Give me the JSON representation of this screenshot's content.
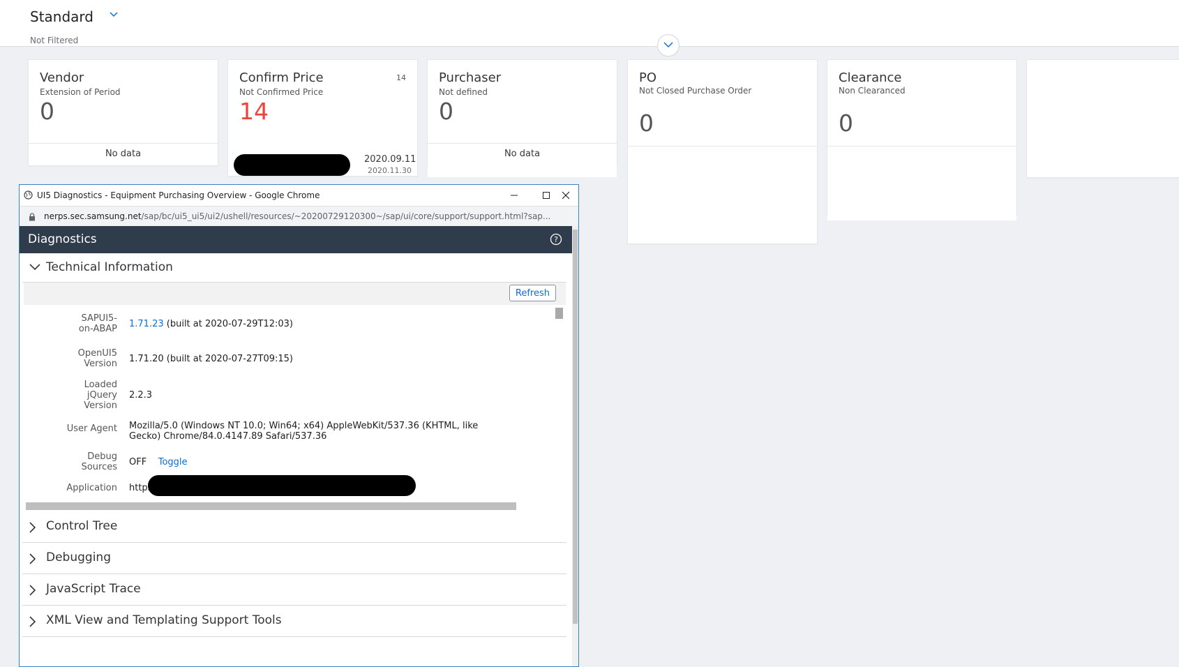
{
  "header": {
    "variant_title": "Standard",
    "filter_status": "Not Filtered"
  },
  "cards": [
    {
      "title": "Vendor",
      "subtitle": "Extension of Period",
      "kpi": "0",
      "footer": "No data"
    },
    {
      "title": "Confirm Price",
      "subtitle": "Not Confirmed Price",
      "kpi": "14",
      "count": "14",
      "date1": "2020.09.11",
      "date2": "2020.11.30",
      "kpi_color": "#e9453a"
    },
    {
      "title": "Purchaser",
      "subtitle": "Not defined",
      "kpi": "0",
      "footer": "No data"
    },
    {
      "title": "PO",
      "subtitle": "Not Closed Purchase Order",
      "kpi": "0"
    },
    {
      "title": "Clearance",
      "subtitle": "Non Clearanced",
      "kpi": "0"
    }
  ],
  "popup": {
    "window_title": "UI5 Diagnostics - Equipment Purchasing Overview - Google Chrome",
    "url_host": "nerps.sec.samsung.net",
    "url_path": "/sap/bc/ui5_ui5/ui2/ushell/resources/~20200729120300~/sap/ui/core/support/support.html?sap...",
    "panel_title": "Diagnostics",
    "sections": {
      "technical": "Technical Information",
      "control_tree": "Control Tree",
      "debugging": "Debugging",
      "js_trace": "JavaScript Trace",
      "xml_view": "XML View and Templating Support Tools"
    },
    "refresh_label": "Refresh",
    "info": {
      "sapui5_label": "SAPUI5-on-ABAP",
      "sapui5_version": "1.71.23",
      "sapui5_built": "(built at 2020-07-29T12:03)",
      "openui5_label": "OpenUI5 Version",
      "openui5_value": "1.71.20 (built at 2020-07-27T09:15)",
      "jquery_label": "Loaded jQuery Version",
      "jquery_value": "2.2.3",
      "useragent_label": "User Agent",
      "useragent_value": "Mozilla/5.0 (Windows NT 10.0; Win64; x64) AppleWebKit/537.36 (KHTML, like Gecko) Chrome/84.0.4147.89 Safari/537.36",
      "debug_label": "Debug Sources",
      "debug_value": "OFF",
      "debug_toggle": "Toggle",
      "application_label": "Application",
      "application_value": "https"
    }
  },
  "colors": {
    "shell_bar": "#2f3c4c",
    "link": "#0a6ed1",
    "critical_kpi": "#e9453a"
  }
}
